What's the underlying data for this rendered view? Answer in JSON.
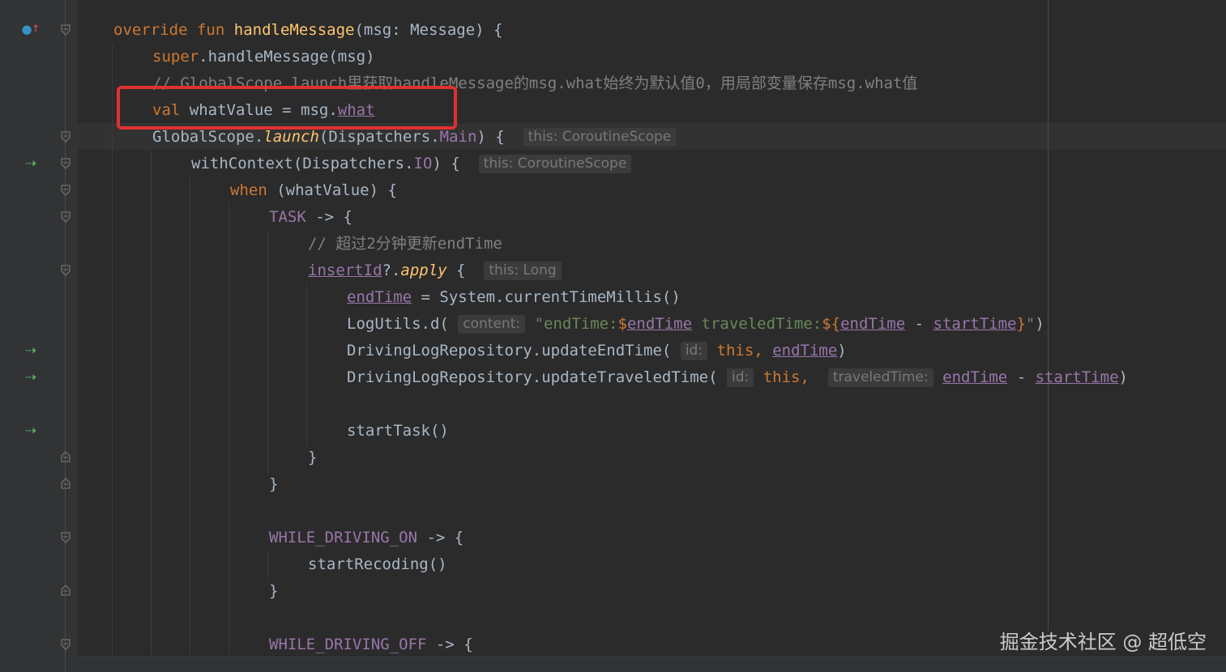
{
  "code": {
    "l1": {
      "override": "override",
      "fun": "fun",
      "name": "handleMessage",
      "rest": "(msg: Message) {"
    },
    "l2": {
      "super": "super",
      "rest": ".handleMessage(msg)"
    },
    "l3": {
      "comment": "// GlobalScope.launch里获取handleMessage的msg.what始终为默认值0，用局部变量保存msg.what值"
    },
    "l4": {
      "val": "val",
      "mid": " whatValue = msg.",
      "what": "what"
    },
    "l5": {
      "a": "GlobalScope.",
      "launch": "launch",
      "b": "(Dispatchers.",
      "main": "Main",
      "c": ") {",
      "hint": "this: CoroutineScope"
    },
    "l6": {
      "a": "withContext(Dispatchers.",
      "io": "IO",
      "c": ") {",
      "hint": "this: CoroutineScope"
    },
    "l7": {
      "when": "when",
      "rest": " (whatValue) {"
    },
    "l8": {
      "task": "TASK",
      "rest": " -> {"
    },
    "l9": {
      "comment": "// 超过2分钟更新endTime"
    },
    "l10": {
      "insertId": "insertId",
      "q": "?.",
      "apply": "apply",
      "brace": " {",
      "hint": "this: Long"
    },
    "l11": {
      "endTime": "endTime",
      "rest": " = System.currentTimeMillis()"
    },
    "l12": {
      "a": "LogUtils.d(",
      "hint": "content:",
      "s1": "\"endTime:",
      "d1": "$",
      "v1": "endTime",
      "s2": " traveledTime:",
      "d2": "${",
      "v2": "endTime",
      "minus": " - ",
      "v3": "startTime",
      "d3": "}",
      "s3": "\"",
      "close": ")"
    },
    "l13": {
      "a": "DrivingLogRepository.updateEndTime(",
      "hint": "id:",
      "this": "this,",
      "v": "endTime",
      "close": ")"
    },
    "l14": {
      "a": "DrivingLogRepository.updateTraveledTime(",
      "hint1": "id:",
      "this": "this,",
      "hint2": "traveledTime:",
      "v1": "endTime",
      "minus": " - ",
      "v2": "startTime",
      "close": ")"
    },
    "l16": {
      "text": "startTask()"
    },
    "l17": {
      "text": "}"
    },
    "l18": {
      "text": "}"
    },
    "l20": {
      "name": "WHILE_DRIVING_ON",
      "rest": " -> {"
    },
    "l21": {
      "text": "startRecoding()"
    },
    "l22": {
      "text": "}"
    },
    "l24": {
      "name": "WHILE_DRIVING_OFF",
      "rest": " -> {"
    }
  },
  "gutter": {
    "override_icon": "override-method-icon",
    "suspend_icon": "suspend-call-icon"
  },
  "watermark": "掘金技术社区 @ 超低空",
  "colors": {
    "keyword": "#cc7832",
    "function": "#ffc66d",
    "property": "#9876aa",
    "string": "#6a8759",
    "comment": "#808080",
    "highlight": "#e03131"
  }
}
